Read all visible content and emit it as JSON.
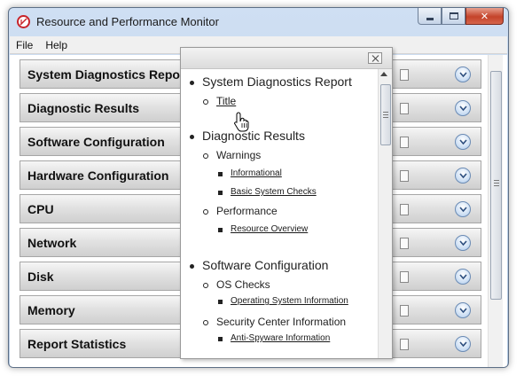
{
  "window": {
    "title": "Resource and Performance Monitor",
    "icon": "resource-monitor-icon",
    "caption_buttons": {
      "minimize": "minimize-icon",
      "maximize": "maximize-icon",
      "close": "✕"
    }
  },
  "menu": {
    "items": [
      "File",
      "Help"
    ]
  },
  "sections": [
    {
      "label": "System Diagnostics Report"
    },
    {
      "label": "Diagnostic Results"
    },
    {
      "label": "Software Configuration"
    },
    {
      "label": "Hardware Configuration"
    },
    {
      "label": "CPU"
    },
    {
      "label": "Network"
    },
    {
      "label": "Disk"
    },
    {
      "label": "Memory"
    },
    {
      "label": "Report Statistics"
    }
  ],
  "toc": {
    "items": [
      {
        "level": 1,
        "text": "System Diagnostics Report",
        "link": false
      },
      {
        "level": 2,
        "text": "Title",
        "link": true
      },
      {
        "level": 1,
        "text": "Diagnostic Results",
        "link": false
      },
      {
        "level": 2,
        "text": "Warnings",
        "link": false
      },
      {
        "level": 3,
        "text": "Informational",
        "link": true
      },
      {
        "level": 3,
        "text": "Basic System Checks",
        "link": true
      },
      {
        "level": 2,
        "text": "Performance",
        "link": false
      },
      {
        "level": 3,
        "text": "Resource Overview",
        "link": true
      },
      {
        "level": 1,
        "text": "Software Configuration",
        "link": false
      },
      {
        "level": 2,
        "text": "OS Checks",
        "link": false
      },
      {
        "level": 3,
        "text": "Operating System Information",
        "link": true
      },
      {
        "level": 2,
        "text": "Security Center Information",
        "link": false
      },
      {
        "level": 3,
        "text": "Anti-Spyware Information",
        "link": true
      }
    ]
  },
  "colors": {
    "accent": "#c8242b",
    "expand_button": "#c8dcf3"
  }
}
